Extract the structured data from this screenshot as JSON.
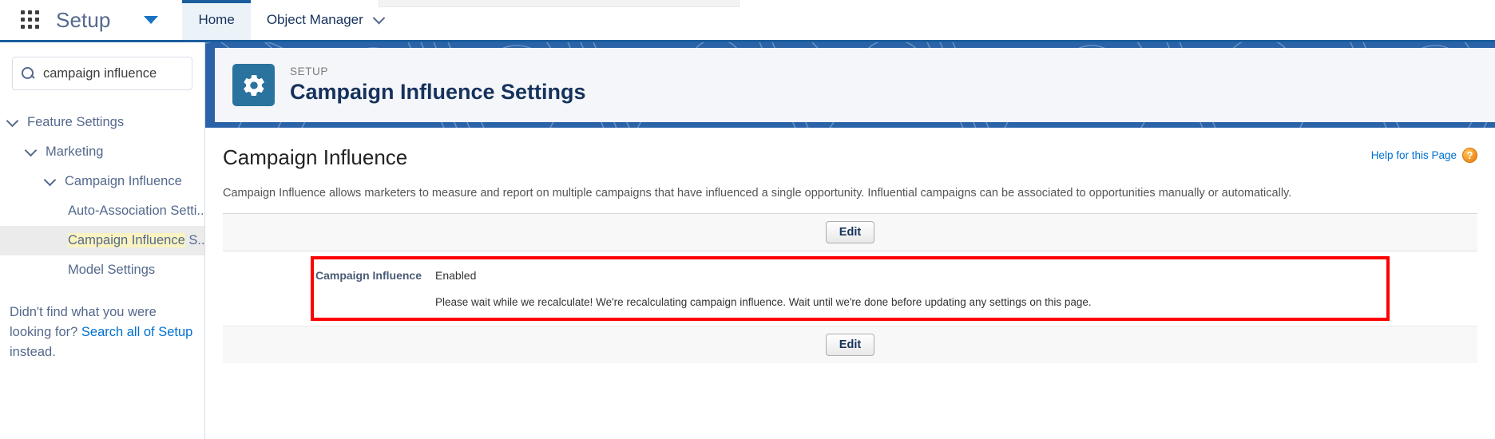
{
  "global_header": {
    "app_launcher_icon": "waffle-icon",
    "setup_label": "Setup",
    "setup_caret_icon": "caret-down-icon",
    "tabs": [
      {
        "label": "Home",
        "active": true
      },
      {
        "label": "Object Manager",
        "active": false,
        "chevron_icon": "chevron-down-icon"
      }
    ]
  },
  "sidebar": {
    "search": {
      "icon": "search-icon",
      "value": "campaign influence",
      "placeholder": "Quick Find"
    },
    "tree": [
      {
        "label": "Feature Settings",
        "indent": 0,
        "expanded": true,
        "chevron_icon": "chevron-down-icon",
        "selected": false
      },
      {
        "label": "Marketing",
        "indent": 1,
        "expanded": true,
        "chevron_icon": "chevron-down-icon",
        "selected": false
      },
      {
        "label": "Campaign Influence",
        "indent": 2,
        "expanded": true,
        "chevron_icon": "chevron-down-icon",
        "selected": false
      },
      {
        "label": "Auto-Association Setti...",
        "indent": 3,
        "expanded": false,
        "selected": false
      },
      {
        "label_highlight": "Campaign Influence",
        "label_rest": " S...",
        "indent": 3,
        "expanded": false,
        "selected": true
      },
      {
        "label": "Model Settings",
        "indent": 3,
        "expanded": false,
        "selected": false
      }
    ],
    "footer": {
      "text_before": "Didn't find what you were looking for? ",
      "link_text": "Search all of Setup",
      "text_after": " instead."
    }
  },
  "page_header": {
    "icon": "gear-icon",
    "eyebrow": "SETUP",
    "title": "Campaign Influence Settings",
    "icon_bg": "#2a739e",
    "banner_bg": "#2b63a8"
  },
  "content": {
    "help_link": {
      "label": "Help for this Page",
      "icon": "help-question-icon",
      "icon_glyph": "?",
      "color": "#0070d2"
    },
    "section_title": "Campaign Influence",
    "description": "Campaign Influence allows marketers to measure and report on multiple campaigns that have influenced a single opportunity. Influential campaigns can be associated to opportunities manually or automatically.",
    "edit_button_top": "Edit",
    "edit_button_bottom": "Edit",
    "highlight_border_color": "#fe0000",
    "fields": [
      {
        "label": "Campaign Influence",
        "value": "Enabled"
      }
    ],
    "recalculating_note": "Please wait while we recalculate! We're recalculating campaign influence. Wait until we're done before updating any settings on this page."
  }
}
